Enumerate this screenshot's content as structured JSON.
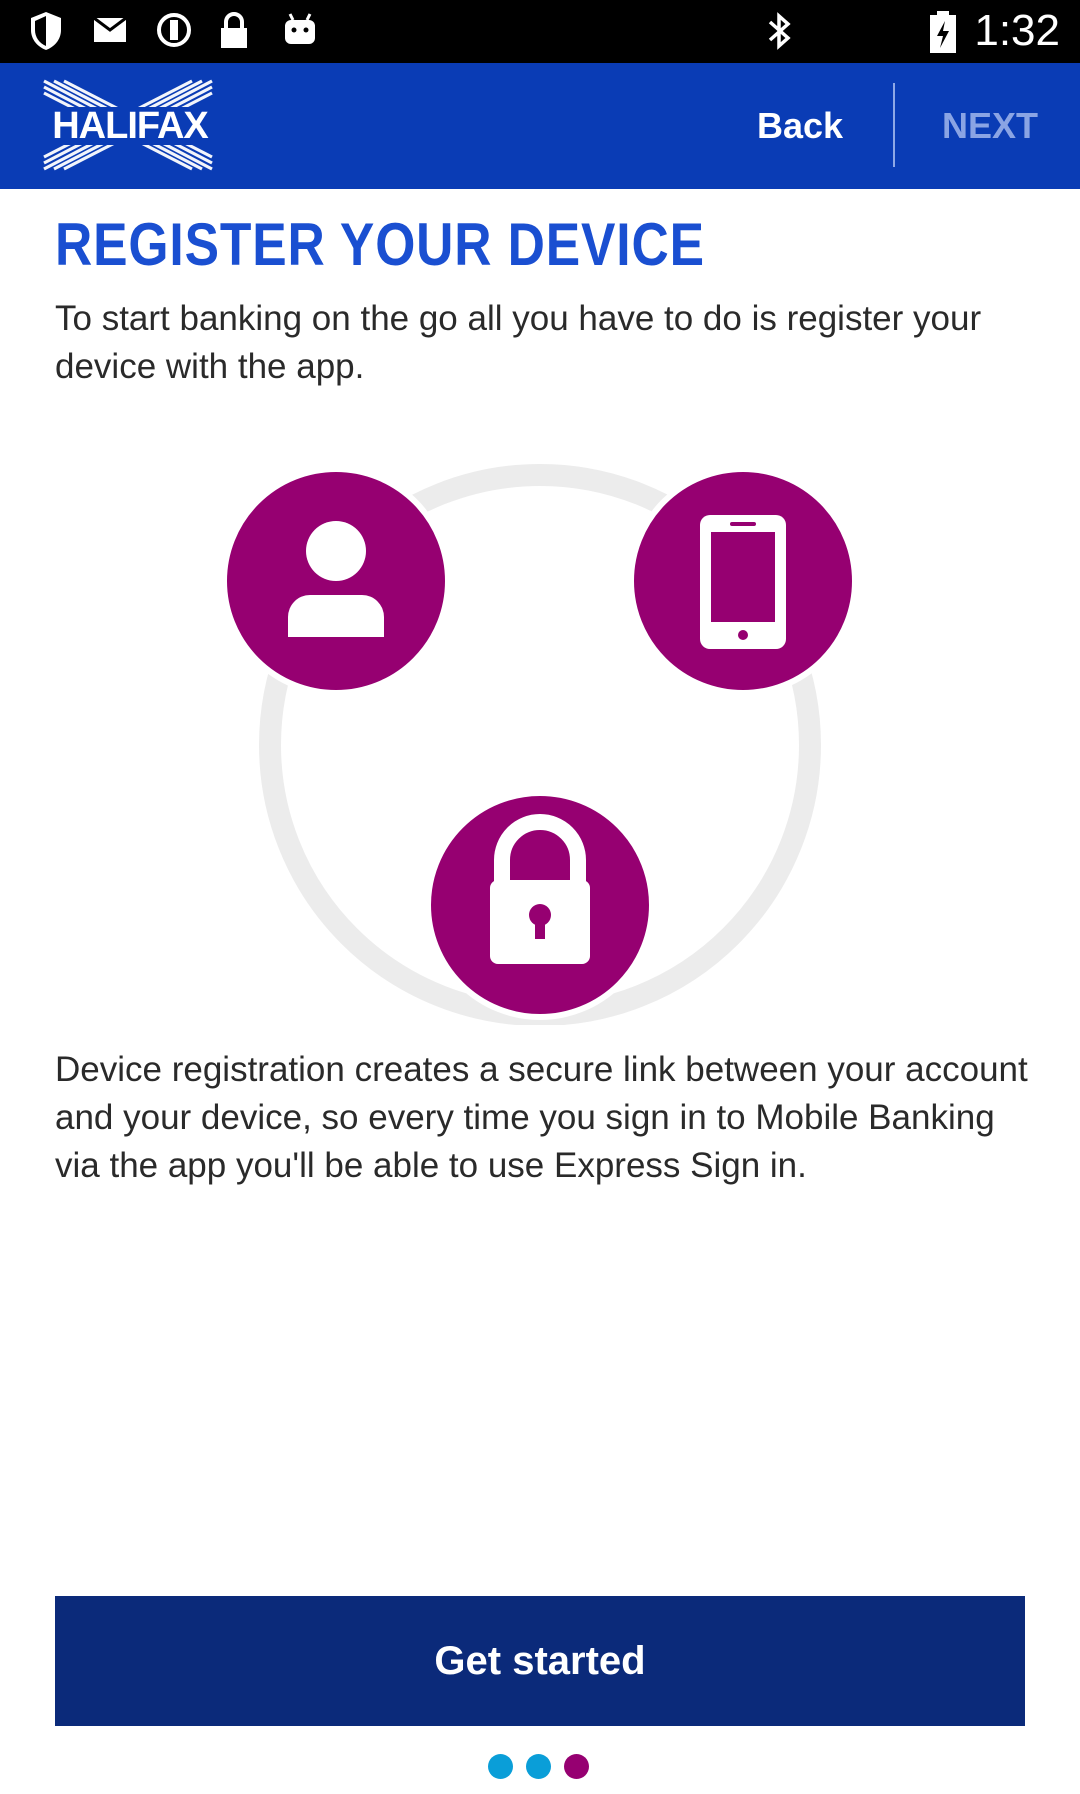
{
  "status_bar": {
    "time": "1:32",
    "left_icons": [
      "shield-icon",
      "mail-icon",
      "sync-icon",
      "lock-icon",
      "android-icon"
    ],
    "right_icons": [
      "bluetooth-icon",
      "battery-icon"
    ]
  },
  "header": {
    "logo_text": "HALIFAX",
    "back_label": "Back",
    "next_label": "NEXT"
  },
  "main": {
    "title": "REGISTER YOUR DEVICE",
    "intro": "To start banking on the go all you have to do is register your device with the app.",
    "illustration_icons": [
      "person-icon",
      "phone-icon",
      "padlock-icon"
    ],
    "description": "Device registration creates a secure link between your account and your device, so every time you sign in to Mobile Banking via the app you'll be able to use Express Sign in."
  },
  "footer": {
    "cta_label": "Get started",
    "pager": {
      "total": 3,
      "current": 3
    }
  },
  "colors": {
    "header_blue": "#0a3cb5",
    "title_blue": "#1a4fd1",
    "button_navy": "#0b2a7a",
    "icon_purple": "#960071",
    "dot_blue": "#0a9ed8",
    "dot_active": "#960071"
  }
}
